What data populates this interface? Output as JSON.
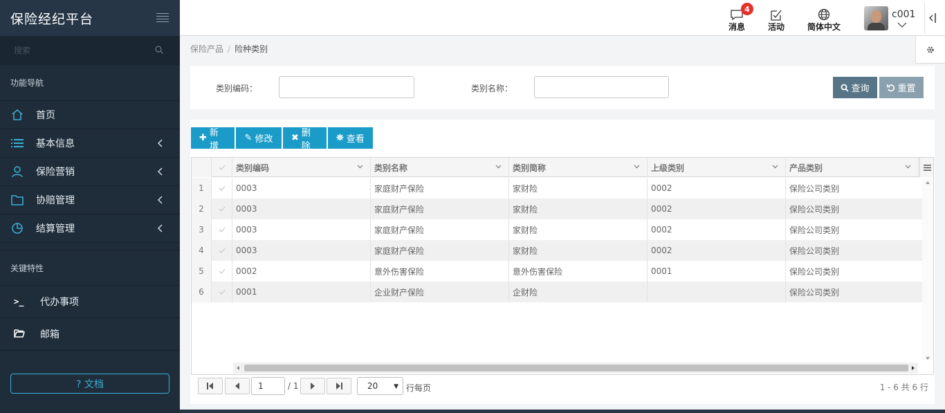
{
  "app": {
    "title": "保险经纪平台"
  },
  "sidebar": {
    "search_placeholder": "搜索",
    "nav_section_title": "功能导航",
    "nav_items": [
      {
        "label": "首页",
        "icon": "home-icon"
      },
      {
        "label": "基本信息",
        "icon": "list-icon"
      },
      {
        "label": "保险营销",
        "icon": "user-icon"
      },
      {
        "label": "协赔管理",
        "icon": "folder-icon"
      },
      {
        "label": "结算管理",
        "icon": "pie-chart-icon"
      }
    ],
    "features_section_title": "关键特性",
    "feature_items": [
      {
        "label": "代办事项",
        "icon": "terminal-icon"
      },
      {
        "label": "邮箱",
        "icon": "folder-open-icon"
      }
    ],
    "doc_button": "? 文档"
  },
  "topbar": {
    "messages": {
      "label": "消息",
      "count": "4"
    },
    "activity": {
      "label": "活动"
    },
    "language": {
      "label": "简体中文"
    },
    "user": {
      "name": "c001"
    }
  },
  "breadcrumb": {
    "parent": "保险产品",
    "separator": "/",
    "current": "险种类别"
  },
  "filter": {
    "code_label": "类别编码：",
    "name_label": "类别名称：",
    "code_value": "",
    "name_value": "",
    "query_button": "查询",
    "reset_button": "重置"
  },
  "toolbar": {
    "add": "新增",
    "edit": "修改",
    "delete": "删除",
    "view": "查看"
  },
  "table": {
    "columns": [
      "类别编码",
      "类别名称",
      "类别简称",
      "上级类别",
      "产品类别"
    ],
    "rows": [
      {
        "num": "1",
        "code": "0003",
        "name": "家庭财产保险",
        "short": "家财险",
        "parent": "0002",
        "product": "保险公司类别"
      },
      {
        "num": "2",
        "code": "0003",
        "name": "家庭财产保险",
        "short": "家财险",
        "parent": "0002",
        "product": "保险公司类别"
      },
      {
        "num": "3",
        "code": "0003",
        "name": "家庭财产保险",
        "short": "家财险",
        "parent": "0002",
        "product": "保险公司类别"
      },
      {
        "num": "4",
        "code": "0003",
        "name": "家庭财产保险",
        "short": "家财险",
        "parent": "0002",
        "product": "保险公司类别"
      },
      {
        "num": "5",
        "code": "0002",
        "name": "意外伤害保险",
        "short": "意外伤害保险",
        "parent": "0001",
        "product": "保险公司类别"
      },
      {
        "num": "6",
        "code": "0001",
        "name": "企业财产保险",
        "short": "企财险",
        "parent": "",
        "product": "保险公司类别"
      }
    ]
  },
  "pager": {
    "current_page": "1",
    "total_pages": "/ 1",
    "page_size": "20",
    "page_size_label": "行每页",
    "info": "1 - 6 共 6 行"
  },
  "colors": {
    "sidebar_bg": "#1f2d3a",
    "accent": "#1a9bc8",
    "query_button": "#587588",
    "badge": "#e6302a"
  }
}
